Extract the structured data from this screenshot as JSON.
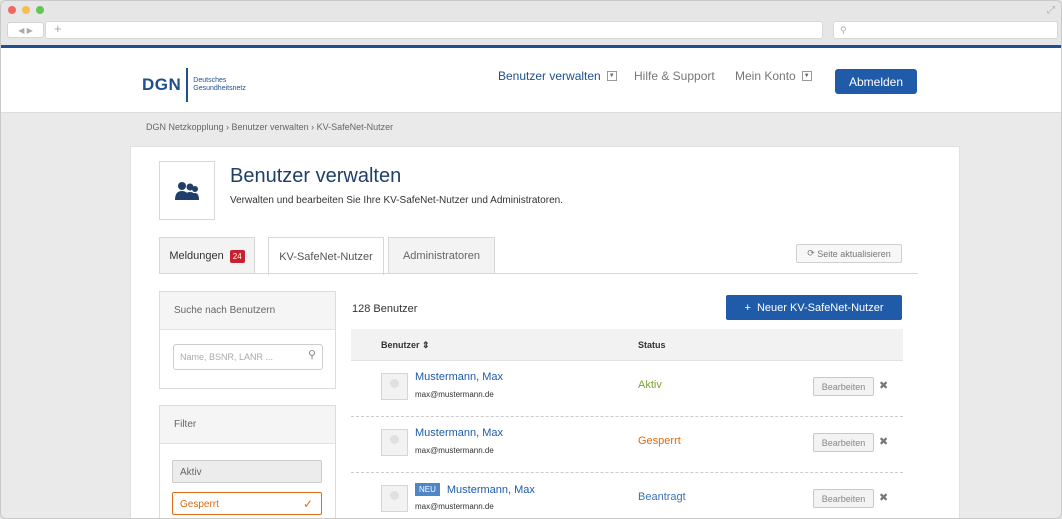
{
  "browser": {
    "nav_back_forward": "◀ ▶",
    "new_tab": "+",
    "search_icon": "⚲"
  },
  "header": {
    "logo_text": "DGN",
    "logo_sub_1": "Deutsches",
    "logo_sub_2": "Gesundheitsnetz",
    "nav": [
      {
        "label": "Benutzer verwalten",
        "has_dropdown": true
      },
      {
        "label": "Hilfe & Support",
        "has_dropdown": false
      },
      {
        "label": "Mein Konto",
        "has_dropdown": true
      }
    ],
    "logout_label": "Abmelden"
  },
  "breadcrumb": "DGN Netzkopplung  ›  Benutzer verwalten  ›  KV-SafeNet-Nutzer",
  "page": {
    "title": "Benutzer verwalten",
    "description": "Verwalten und bearbeiten Sie Ihre KV-SafeNet-Nutzer und Administratoren."
  },
  "tabs": [
    {
      "label": "Meldungen",
      "badge": "24"
    },
    {
      "label": "KV-SafeNet-Nutzer"
    },
    {
      "label": "Administratoren"
    }
  ],
  "refresh_label": "Seite aktualisieren",
  "search": {
    "heading": "Suche nach Benutzern",
    "placeholder": "Name, BSNR, LANR ..."
  },
  "filter": {
    "heading": "Filter",
    "options": [
      "Aktiv",
      "Gesperrt"
    ],
    "selected": "Gesperrt"
  },
  "users": {
    "count_label": "128 Benutzer",
    "new_button_label": "Neuer KV-SafeNet-Nutzer",
    "columns": {
      "user": "Benutzer",
      "status": "Status"
    },
    "sort_indicator": "⇕",
    "edit_label": "Bearbeiten",
    "delete_glyph": "✖",
    "rows": [
      {
        "name": "Mustermann, Max",
        "email": "max@mustermann.de",
        "status": "Aktiv",
        "new_badge": ""
      },
      {
        "name": "Mustermann, Max",
        "email": "max@mustermann.de",
        "status": "Gesperrt",
        "new_badge": ""
      },
      {
        "name": "Mustermann, Max",
        "email": "max@mustermann.de",
        "status": "Beantragt",
        "new_badge": "NEU"
      }
    ]
  },
  "colors": {
    "brand_blue": "#1f4f8e",
    "button_blue": "#1f5ba8",
    "status_aktiv": "#7aa52f",
    "status_gesperrt": "#e06b10",
    "status_beantragt": "#3a72b5",
    "badge_red": "#c8202e"
  }
}
